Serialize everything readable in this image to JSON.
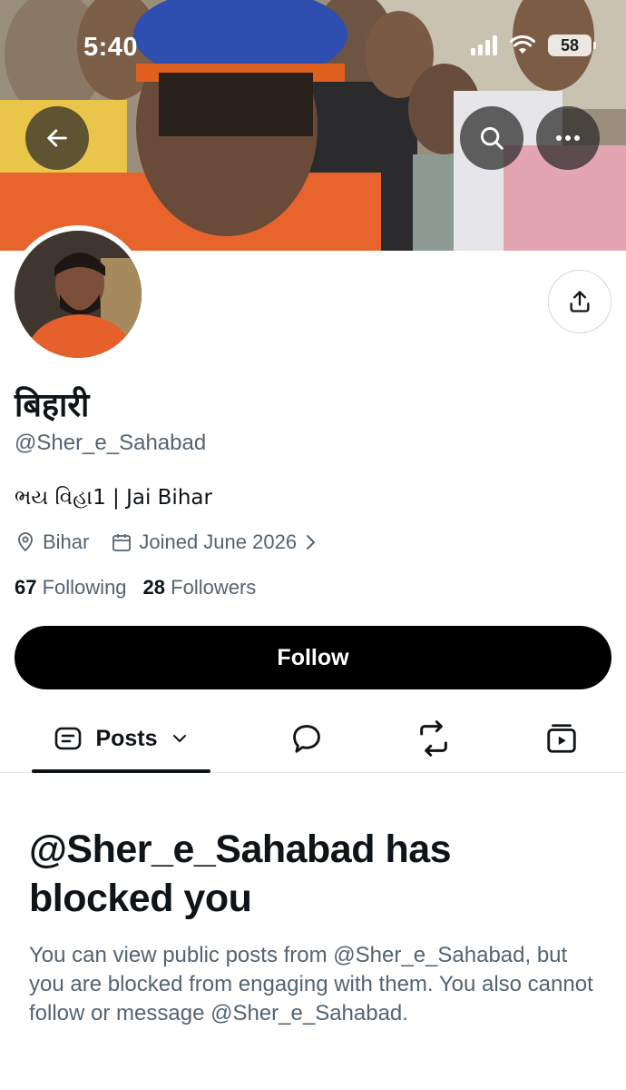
{
  "status_bar": {
    "time": "5:40",
    "battery": "58"
  },
  "header": {
    "back_icon": "arrow-left-icon",
    "search_icon": "search-icon",
    "more_icon": "more-horizontal-icon"
  },
  "profile": {
    "display_name": "बिहारी",
    "handle": "@Sher_e_Sahabad",
    "bio": "ભય વિહા1 | Jai Bihar",
    "location": "Bihar",
    "joined": "Joined June 2026",
    "following_count": "67",
    "following_label": "Following",
    "followers_count": "28",
    "followers_label": "Followers"
  },
  "actions": {
    "follow_label": "Follow",
    "share_icon": "share-icon"
  },
  "tabs": {
    "posts_label": "Posts",
    "replies_icon": "reply-bubble-icon",
    "reposts_icon": "repost-icon",
    "media_icon": "media-icon"
  },
  "blocked": {
    "title": "@Sher_e_Sahabad has blocked you",
    "body": "You can view public posts from @Sher_e_Sahabad, but you are blocked from engaging with them. You also cannot follow or message @Sher_e_Sahabad."
  },
  "colors": {
    "text_primary": "#0f1419",
    "text_secondary": "#536471",
    "follow_bg": "#000000",
    "divider": "#e7e9ea"
  }
}
